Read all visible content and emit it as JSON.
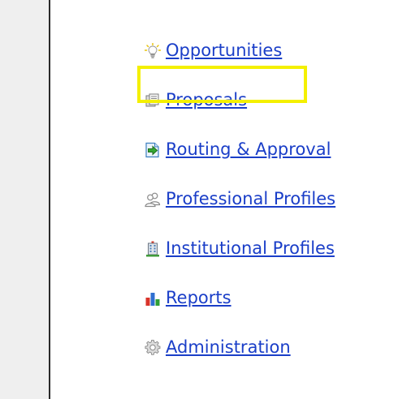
{
  "nav": {
    "items": [
      {
        "label": "Opportunities",
        "icon": "lightbulb-icon"
      },
      {
        "label": "Proposals",
        "icon": "proposal-documents-icon",
        "highlighted": true
      },
      {
        "label": "Routing & Approval",
        "icon": "routing-arrow-icon"
      },
      {
        "label": "Professional Profiles",
        "icon": "people-icon"
      },
      {
        "label": "Institutional Profiles",
        "icon": "building-icon"
      },
      {
        "label": "Reports",
        "icon": "bar-chart-icon"
      },
      {
        "label": "Administration",
        "icon": "gear-icon"
      }
    ]
  },
  "colors": {
    "link": "#1a3ec8",
    "highlight": "#f4f000",
    "left_panel": "#efefef",
    "divider": "#2b2b2b"
  }
}
